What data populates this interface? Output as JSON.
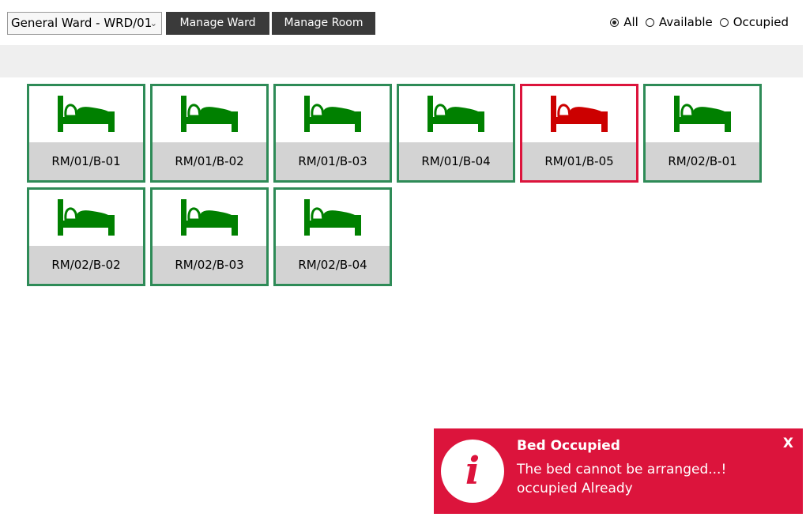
{
  "toolbar": {
    "ward_select_value": "General Ward - WRD/01",
    "manage_ward_label": "Manage Ward",
    "manage_room_label": "Manage Room"
  },
  "filters": [
    {
      "label": "All",
      "checked": true
    },
    {
      "label": "Available",
      "checked": false
    },
    {
      "label": "Occupied",
      "checked": false
    }
  ],
  "colors": {
    "available": "#008000",
    "occupied": "#cc0000",
    "available_border": "#2e8b57",
    "occupied_border": "#dc143c",
    "toast_bg": "#dc143c"
  },
  "beds": [
    {
      "label": "RM/01/B-01",
      "status": "available"
    },
    {
      "label": "RM/01/B-02",
      "status": "available"
    },
    {
      "label": "RM/01/B-03",
      "status": "available"
    },
    {
      "label": "RM/01/B-04",
      "status": "available"
    },
    {
      "label": "RM/01/B-05",
      "status": "occupied"
    },
    {
      "label": "RM/02/B-01",
      "status": "available"
    },
    {
      "label": "RM/02/B-02",
      "status": "available"
    },
    {
      "label": "RM/02/B-03",
      "status": "available"
    },
    {
      "label": "RM/02/B-04",
      "status": "available"
    }
  ],
  "toast": {
    "icon": "info-icon",
    "title": "Bed Occupied",
    "line1": "The bed cannot be arranged...!",
    "line2": "occupied Already",
    "close_label": "X"
  }
}
